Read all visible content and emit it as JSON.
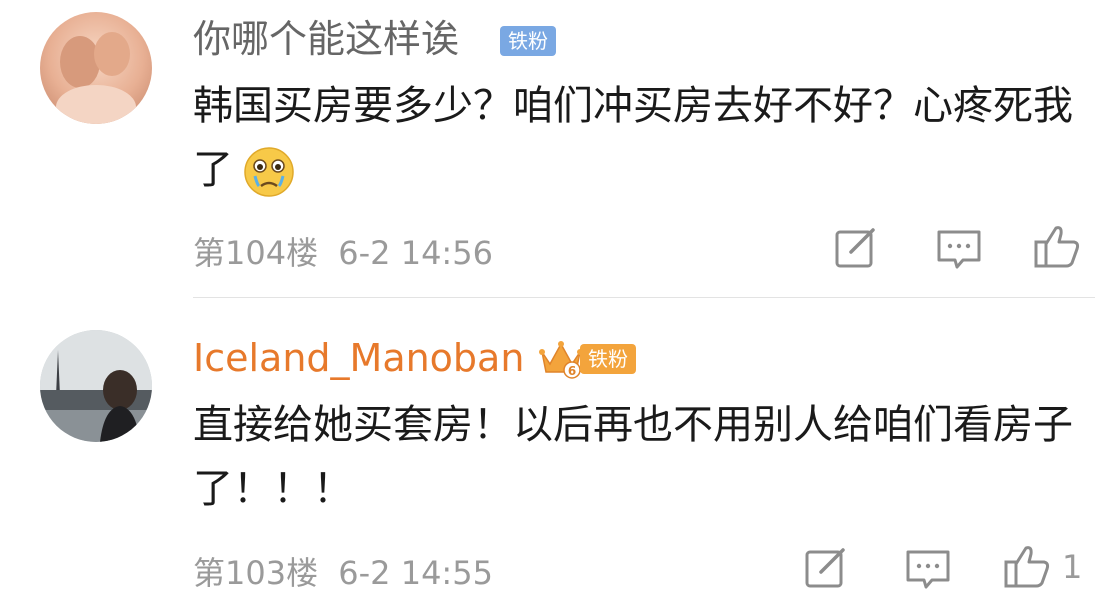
{
  "comments": [
    {
      "username": "你哪个能这样诶",
      "badge": "铁粉",
      "text": "韩国买房要多少？咱们冲买房去好不好？心疼死我了",
      "emoji": "crying-face-icon",
      "floor": "第104楼",
      "time": "6-2 14:56",
      "likes": ""
    },
    {
      "username": "Iceland_Manoban",
      "badge": "铁粉",
      "badge_level": "6",
      "text": "直接给她买套房！以后再也不用别人给咱们看房子了！！！",
      "floor": "第103楼",
      "time": "6-2 14:55",
      "likes": "1"
    }
  ],
  "colors": {
    "username_default": "#666666",
    "username_highlight": "#e7792b",
    "badge_blue": "#7aa8e3",
    "badge_orange": "#f3a43c",
    "meta": "#9a9a9a"
  }
}
